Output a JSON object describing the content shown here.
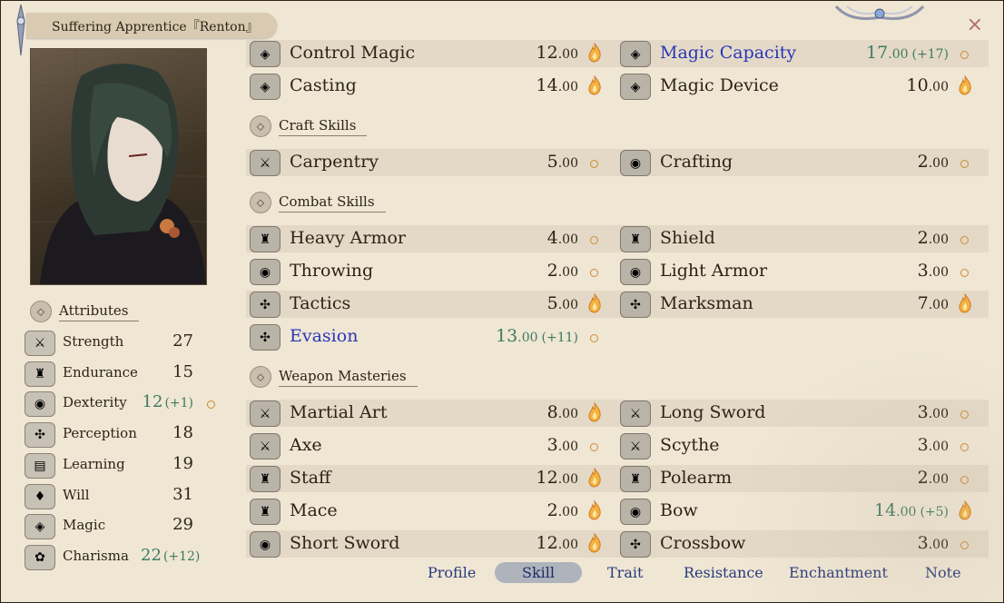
{
  "window": {
    "title": "Suffering Apprentice『Renton』",
    "close_glyph": "×"
  },
  "attributes_heading": "Attributes",
  "attributes": [
    {
      "name": "Strength",
      "value": "27",
      "bonus": "",
      "icon": "crossed-swords-icon",
      "glyph": "⚔",
      "potential": false
    },
    {
      "name": "Endurance",
      "value": "15",
      "bonus": "",
      "icon": "armor-icon",
      "glyph": "♜",
      "potential": false
    },
    {
      "name": "Dexterity",
      "value": "12",
      "bonus": "(+1)",
      "icon": "ring-icon",
      "glyph": "◉",
      "potential": true
    },
    {
      "name": "Perception",
      "value": "18",
      "bonus": "",
      "icon": "perception-icon",
      "glyph": "✣",
      "potential": false
    },
    {
      "name": "Learning",
      "value": "19",
      "bonus": "",
      "icon": "book-icon",
      "glyph": "▤",
      "potential": false
    },
    {
      "name": "Will",
      "value": "31",
      "bonus": "",
      "icon": "will-icon",
      "glyph": "♦",
      "potential": false
    },
    {
      "name": "Magic",
      "value": "29",
      "bonus": "",
      "icon": "magic-icon",
      "glyph": "◈",
      "potential": false
    },
    {
      "name": "Charisma",
      "value": "22",
      "bonus": "(+12)",
      "icon": "ribbon-icon",
      "glyph": "✿",
      "potential": false
    }
  ],
  "sections": [
    {
      "heading": "Craft Skills"
    },
    {
      "heading": "Combat Skills"
    },
    {
      "heading": "Weapon Masteries"
    }
  ],
  "skills": [
    {
      "name": "Control Magic",
      "int": "12",
      "dec": ".00",
      "bonus": "",
      "potential": "flame",
      "icon": "magic-icon",
      "glyph": "◈",
      "highlight": false
    },
    {
      "name": "Magic Capacity",
      "int": "17",
      "dec": ".00",
      "bonus": "(+17)",
      "potential": "dot",
      "icon": "magic-icon",
      "glyph": "◈",
      "highlight": true
    },
    {
      "name": "Casting",
      "int": "14",
      "dec": ".00",
      "bonus": "",
      "potential": "flame",
      "icon": "magic-icon",
      "glyph": "◈",
      "highlight": false
    },
    {
      "name": "Magic Device",
      "int": "10",
      "dec": ".00",
      "bonus": "",
      "potential": "flame",
      "icon": "magic-icon",
      "glyph": "◈",
      "highlight": false
    },
    {
      "name": "Carpentry",
      "int": "5",
      "dec": ".00",
      "bonus": "",
      "potential": "dot",
      "icon": "crossed-swords-icon",
      "glyph": "⚔",
      "highlight": false
    },
    {
      "name": "Crafting",
      "int": "2",
      "dec": ".00",
      "bonus": "",
      "potential": "dot",
      "icon": "ring-icon",
      "glyph": "◉",
      "highlight": false
    },
    {
      "name": "Heavy Armor",
      "int": "4",
      "dec": ".00",
      "bonus": "",
      "potential": "dot",
      "icon": "armor-icon",
      "glyph": "♜",
      "highlight": false
    },
    {
      "name": "Shield",
      "int": "2",
      "dec": ".00",
      "bonus": "",
      "potential": "dot",
      "icon": "armor-icon",
      "glyph": "♜",
      "highlight": false
    },
    {
      "name": "Throwing",
      "int": "2",
      "dec": ".00",
      "bonus": "",
      "potential": "dot",
      "icon": "ring-icon",
      "glyph": "◉",
      "highlight": false
    },
    {
      "name": "Light Armor",
      "int": "3",
      "dec": ".00",
      "bonus": "",
      "potential": "dot",
      "icon": "ring-icon",
      "glyph": "◉",
      "highlight": false
    },
    {
      "name": "Tactics",
      "int": "5",
      "dec": ".00",
      "bonus": "",
      "potential": "flame",
      "icon": "perception-icon",
      "glyph": "✣",
      "highlight": false
    },
    {
      "name": "Marksman",
      "int": "7",
      "dec": ".00",
      "bonus": "",
      "potential": "flame",
      "icon": "perception-icon",
      "glyph": "✣",
      "highlight": false
    },
    {
      "name": "Evasion",
      "int": "13",
      "dec": ".00",
      "bonus": "(+11)",
      "potential": "dot",
      "icon": "perception-icon",
      "glyph": "✣",
      "highlight": true
    },
    {
      "name": "Martial Art",
      "int": "8",
      "dec": ".00",
      "bonus": "",
      "potential": "flame",
      "icon": "crossed-swords-icon",
      "glyph": "⚔",
      "highlight": false
    },
    {
      "name": "Long Sword",
      "int": "3",
      "dec": ".00",
      "bonus": "",
      "potential": "dot",
      "icon": "crossed-swords-icon",
      "glyph": "⚔",
      "highlight": false
    },
    {
      "name": "Axe",
      "int": "3",
      "dec": ".00",
      "bonus": "",
      "potential": "dot",
      "icon": "crossed-swords-icon",
      "glyph": "⚔",
      "highlight": false
    },
    {
      "name": "Scythe",
      "int": "3",
      "dec": ".00",
      "bonus": "",
      "potential": "dot",
      "icon": "crossed-swords-icon",
      "glyph": "⚔",
      "highlight": false
    },
    {
      "name": "Staff",
      "int": "12",
      "dec": ".00",
      "bonus": "",
      "potential": "flame",
      "icon": "armor-icon",
      "glyph": "♜",
      "highlight": false
    },
    {
      "name": "Polearm",
      "int": "2",
      "dec": ".00",
      "bonus": "",
      "potential": "dot",
      "icon": "armor-icon",
      "glyph": "♜",
      "highlight": false
    },
    {
      "name": "Mace",
      "int": "2",
      "dec": ".00",
      "bonus": "",
      "potential": "flame",
      "icon": "armor-icon",
      "glyph": "♜",
      "highlight": false
    },
    {
      "name": "Bow",
      "int": "14",
      "dec": ".00",
      "bonus": "(+5)",
      "potential": "flame",
      "icon": "ring-icon",
      "glyph": "◉",
      "highlight": false
    },
    {
      "name": "Short Sword",
      "int": "12",
      "dec": ".00",
      "bonus": "",
      "potential": "flame",
      "icon": "ring-icon",
      "glyph": "◉",
      "highlight": false
    },
    {
      "name": "Crossbow",
      "int": "3",
      "dec": ".00",
      "bonus": "",
      "potential": "dot",
      "icon": "perception-icon",
      "glyph": "✣",
      "highlight": false
    }
  ],
  "tabs": [
    {
      "label": "Profile",
      "active": false
    },
    {
      "label": "Skill",
      "active": true
    },
    {
      "label": "Trait",
      "active": false
    },
    {
      "label": "Resistance",
      "active": false
    },
    {
      "label": "Enchantment",
      "active": false
    },
    {
      "label": "Note",
      "active": false
    }
  ],
  "colors": {
    "parchment": "#efe6d4",
    "stripe": "#e3d9c6",
    "highlight_text": "#2a36b8",
    "bonus_text": "#3d7a62",
    "tab_text": "#283a7a",
    "potential_orange": "#f0a23c"
  }
}
